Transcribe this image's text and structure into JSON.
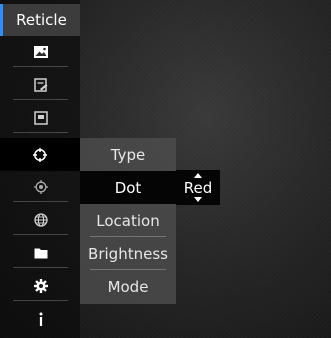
{
  "sidebar": {
    "title": "Reticle",
    "items": [
      {
        "icon": "image-icon"
      },
      {
        "icon": "card-edit-icon"
      },
      {
        "icon": "frame-icon"
      },
      {
        "icon": "reticle-crosshair-icon"
      },
      {
        "icon": "target-dot-icon"
      },
      {
        "icon": "globe-icon"
      },
      {
        "icon": "folder-icon"
      },
      {
        "icon": "gear-icon"
      },
      {
        "icon": "info-icon"
      }
    ],
    "active_index": 3
  },
  "submenu": {
    "items": [
      "Type",
      "Dot",
      "Location",
      "Brightness",
      "Mode"
    ],
    "selected_index": 1
  },
  "value_selector": {
    "value": "Red",
    "up_icon": "arrow-up-icon",
    "down_icon": "arrow-down-icon"
  },
  "colors": {
    "accent": "#2f8cff",
    "selected_background": "#050505",
    "text": "#ffffff"
  }
}
